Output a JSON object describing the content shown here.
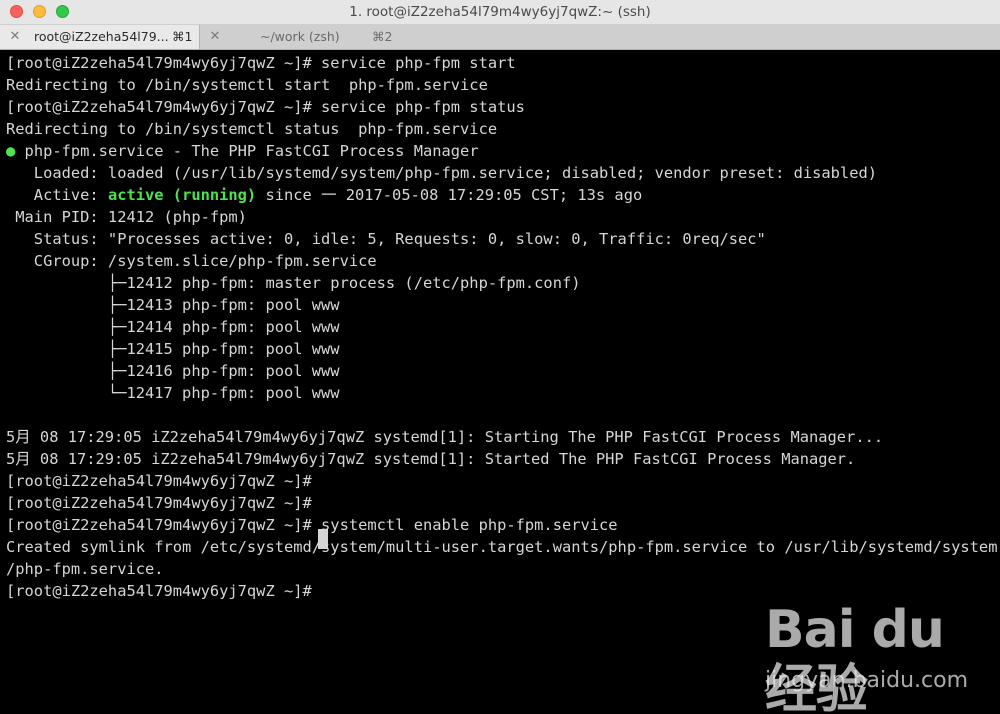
{
  "window": {
    "title": "1. root@iZ2zeha54l79m4wy6yj7qwZ:~ (ssh)"
  },
  "tabs": [
    {
      "label": "root@iZ2zeha54l79...",
      "shortcut": "⌘1",
      "close": "✕"
    },
    {
      "label": "~/work (zsh)",
      "shortcut": "⌘2",
      "close": "✕"
    }
  ],
  "terminal": {
    "lines": [
      {
        "text": "[root@iZ2zeha54l79m4wy6yj7qwZ ~]# service php-fpm start"
      },
      {
        "text": "Redirecting to /bin/systemctl start  php-fpm.service"
      },
      {
        "text": "[root@iZ2zeha54l79m4wy6yj7qwZ ~]# service php-fpm status"
      },
      {
        "text": "Redirecting to /bin/systemctl status  php-fpm.service"
      },
      {
        "pre": "",
        "dot": "●",
        "post": " php-fpm.service - The PHP FastCGI Process Manager"
      },
      {
        "text": "   Loaded: loaded (/usr/lib/systemd/system/php-fpm.service; disabled; vendor preset: disabled)"
      },
      {
        "pre": "   Active: ",
        "green": "active (running)",
        "post": " since 一 2017-05-08 17:29:05 CST; 13s ago"
      },
      {
        "text": " Main PID: 12412 (php-fpm)"
      },
      {
        "text": "   Status: \"Processes active: 0, idle: 5, Requests: 0, slow: 0, Traffic: 0req/sec\""
      },
      {
        "text": "   CGroup: /system.slice/php-fpm.service"
      },
      {
        "text": "           ├─12412 php-fpm: master process (/etc/php-fpm.conf)"
      },
      {
        "text": "           ├─12413 php-fpm: pool www"
      },
      {
        "text": "           ├─12414 php-fpm: pool www"
      },
      {
        "text": "           ├─12415 php-fpm: pool www"
      },
      {
        "text": "           ├─12416 php-fpm: pool www"
      },
      {
        "text": "           └─12417 php-fpm: pool www"
      },
      {
        "text": ""
      },
      {
        "text": "5月 08 17:29:05 iZ2zeha54l79m4wy6yj7qwZ systemd[1]: Starting The PHP FastCGI Process Manager..."
      },
      {
        "text": "5月 08 17:29:05 iZ2zeha54l79m4wy6yj7qwZ systemd[1]: Started The PHP FastCGI Process Manager."
      },
      {
        "text": "[root@iZ2zeha54l79m4wy6yj7qwZ ~]#"
      },
      {
        "text": "[root@iZ2zeha54l79m4wy6yj7qwZ ~]#"
      },
      {
        "text": "[root@iZ2zeha54l79m4wy6yj7qwZ ~]# systemctl enable php-fpm.service"
      },
      {
        "text": "Created symlink from /etc/systemd/system/multi-user.target.wants/php-fpm.service to /usr/lib/systemd/system"
      },
      {
        "text": "/php-fpm.service."
      },
      {
        "text": "[root@iZ2zeha54l79m4wy6yj7qwZ ~]# "
      }
    ]
  },
  "watermark": {
    "logo": "Bai du 经验",
    "subtitle": "jingyan.baidu.com"
  },
  "colors": {
    "terminal_bg": "#000000",
    "terminal_fg": "#d6d6d6",
    "status_green": "#4ee34e",
    "close_red": "#fc605c",
    "minimize_yellow": "#fdbc40",
    "zoom_green": "#34c84a"
  }
}
